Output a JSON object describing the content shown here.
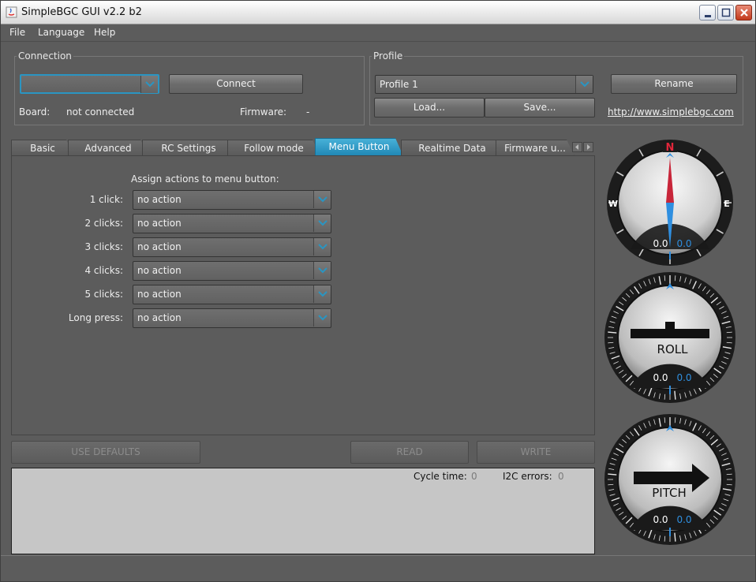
{
  "window": {
    "title": "SimpleBGC GUI v2.2 b2"
  },
  "menu": [
    "File",
    "Language",
    "Help"
  ],
  "connection": {
    "group_title": "Connection",
    "port_value": "",
    "connect_label": "Connect",
    "board_label": "Board:",
    "board_value": "not connected",
    "firmware_label": "Firmware:",
    "firmware_value": "-"
  },
  "profile": {
    "group_title": "Profile",
    "selected": "Profile 1",
    "rename_label": "Rename",
    "load_label": "Load...",
    "save_label": "Save...",
    "website": "http://www.simplebgc.com"
  },
  "tabs": [
    {
      "label": "Basic",
      "active": false
    },
    {
      "label": "Advanced",
      "active": false
    },
    {
      "label": "RC Settings",
      "active": false
    },
    {
      "label": "Follow mode",
      "active": false
    },
    {
      "label": "Menu Button",
      "active": true
    },
    {
      "label": "Realtime Data",
      "active": false
    },
    {
      "label": "Firmware u...",
      "active": false
    }
  ],
  "menu_button": {
    "heading": "Assign actions to menu button:",
    "rows": [
      {
        "label": "1 click:",
        "value": "no action"
      },
      {
        "label": "2 clicks:",
        "value": "no action"
      },
      {
        "label": "3 clicks:",
        "value": "no action"
      },
      {
        "label": "4 clicks:",
        "value": "no action"
      },
      {
        "label": "5 clicks:",
        "value": "no action"
      },
      {
        "label": "Long press:",
        "value": "no action"
      }
    ]
  },
  "actions": {
    "defaults_label": "USE DEFAULTS",
    "read_label": "READ",
    "write_label": "WRITE"
  },
  "log": {
    "cycle_label": "Cycle time:",
    "cycle_value": "0",
    "i2c_label": "I2C errors:",
    "i2c_value": "0"
  },
  "gauges": {
    "compass": {
      "n": "N",
      "w": "W",
      "e": "E",
      "value1": "0.0",
      "value2": "0.0"
    },
    "roll": {
      "label": "ROLL",
      "value1": "0.0",
      "value2": "0.0"
    },
    "pitch": {
      "label": "PITCH",
      "value1": "0.0",
      "value2": "0.0"
    }
  },
  "colors": {
    "accent": "#2a95c2",
    "panel": "#5c5c5c",
    "value_blue": "#2f8fe0",
    "compass_red": "#d0263a"
  }
}
